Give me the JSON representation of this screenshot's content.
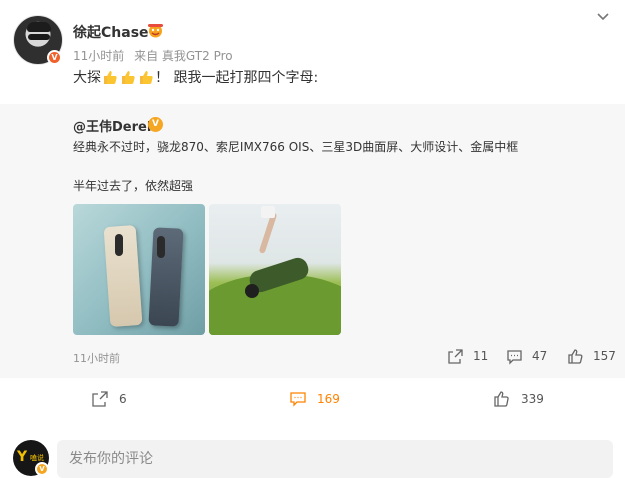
{
  "post": {
    "author": "徐起Chase",
    "time": "11小时前",
    "source": "来自 真我GT2 Pro",
    "text_before": "大探",
    "text_after": "！ 跟我一起打那四个字母:"
  },
  "repost": {
    "author": "@王伟Derek",
    "line1": "经典永不过时，骁龙870、索尼IMX766 OIS、三星3D曲面屏、大师设计、金属中框",
    "line2": "半年过去了，依然超强",
    "time": "11小时前",
    "stats": {
      "repost": "11",
      "comment": "47",
      "like": "157"
    }
  },
  "actions": {
    "repost": "6",
    "comment": "169",
    "like": "339"
  },
  "comment": {
    "placeholder": "发布你的评论",
    "avatar_text": "嗑说"
  },
  "colors": {
    "accent": "#ff8200",
    "verified_gold": "#f5a623",
    "verified_red": "#f0612b"
  }
}
